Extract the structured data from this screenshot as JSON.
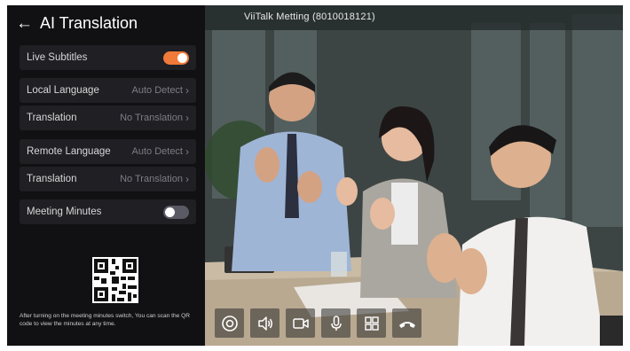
{
  "panel": {
    "title": "AI Translation",
    "rows": {
      "live_subtitles": {
        "label": "Live Subtitles",
        "toggle": "on"
      },
      "local_language": {
        "label": "Local Language",
        "value": "Auto Detect"
      },
      "local_translation": {
        "label": "Translation",
        "value": "No Translation"
      },
      "remote_language": {
        "label": "Remote Language",
        "value": "Auto Detect"
      },
      "remote_translation": {
        "label": "Translation",
        "value": "No Translation"
      },
      "meeting_minutes": {
        "label": "Meeting Minutes",
        "toggle": "off"
      }
    },
    "qr_note": "After turning on the meeting minutes switch, You can scan the QR code to view the minutes at any time."
  },
  "video": {
    "meeting_title": "ViiTalk Metting (8010018121)"
  },
  "controls": [
    {
      "icon": "camera-settings-icon"
    },
    {
      "icon": "speaker-icon"
    },
    {
      "icon": "video-camera-icon"
    },
    {
      "icon": "microphone-icon"
    },
    {
      "icon": "layout-grid-icon"
    },
    {
      "icon": "hang-up-icon"
    }
  ],
  "colors": {
    "toggle_on": "#f07a3a",
    "toggle_off": "#5a5a64",
    "panel_bg": "#111114",
    "row_bg": "#1f1f24"
  }
}
